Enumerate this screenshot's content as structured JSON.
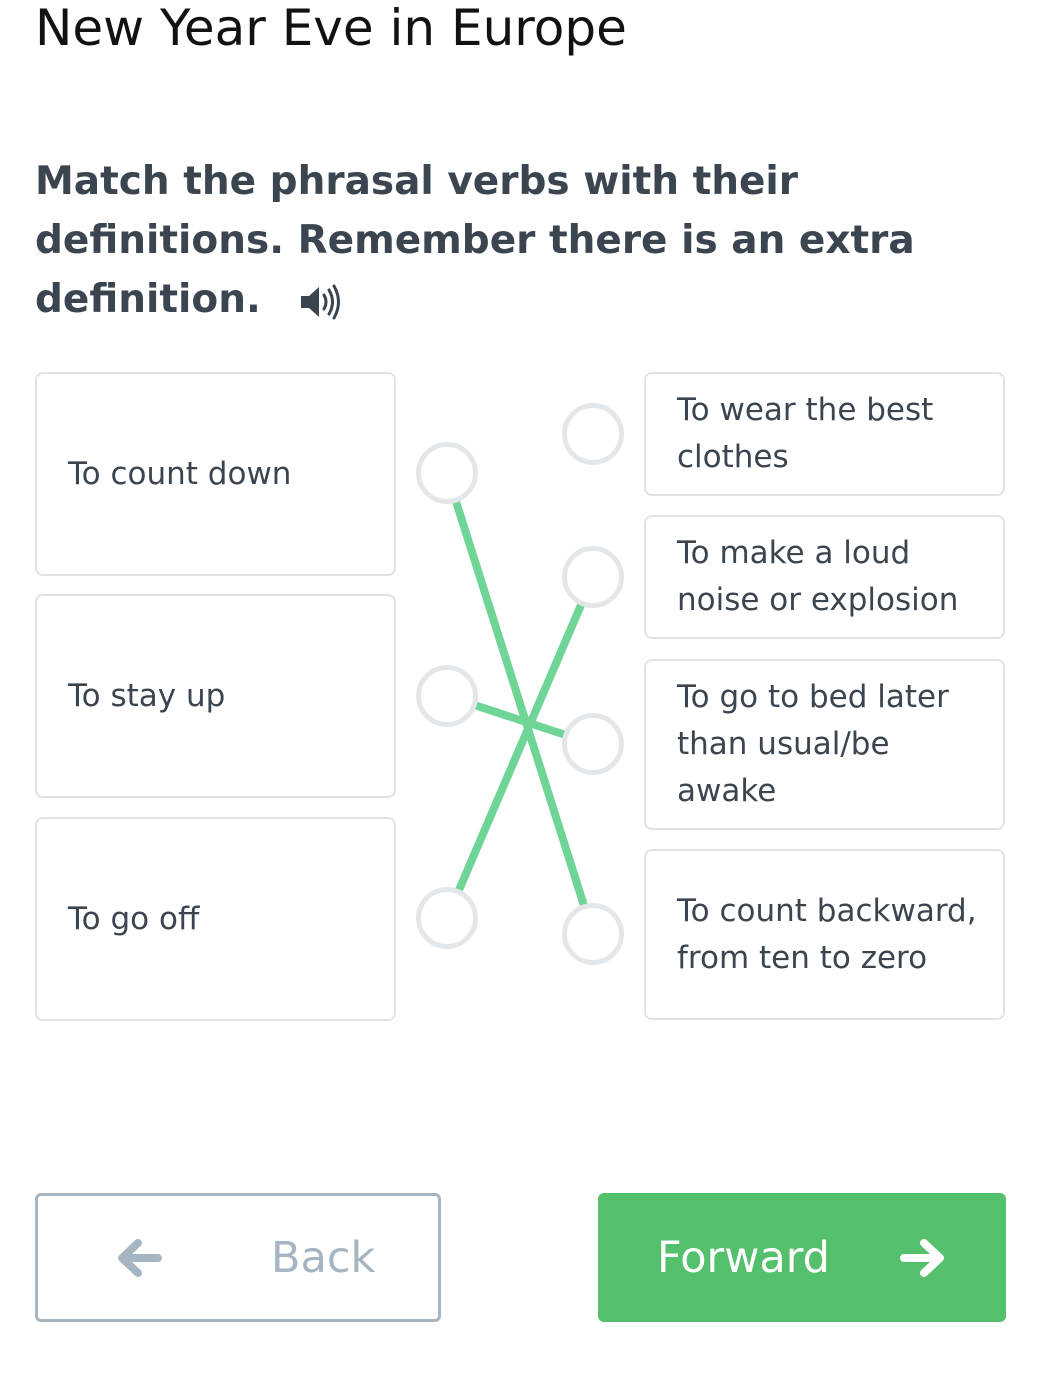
{
  "page": {
    "title": "New Year Eve in Europe"
  },
  "exercise": {
    "instructions": "Match the phrasal verbs with their definitions. Remember there is an extra definition.",
    "audio_icon": "speaker-icon",
    "phrasal_verbs": [
      {
        "text": "To count down"
      },
      {
        "text": "To stay up"
      },
      {
        "text": "To go off"
      }
    ],
    "definitions": [
      {
        "text": "To wear the best clothes"
      },
      {
        "text": "To make a loud noise or explosion"
      },
      {
        "text": "To go to bed later than usual/be awake"
      },
      {
        "text": "To count backward, from ten to zero"
      }
    ],
    "matches": [
      {
        "verb": 0,
        "definition": 3
      },
      {
        "verb": 1,
        "definition": 2
      },
      {
        "verb": 2,
        "definition": 1
      }
    ],
    "line_color": "#6ed597"
  },
  "navigation": {
    "back_label": "Back",
    "forward_label": "Forward",
    "back_icon": "arrow-left-icon",
    "forward_icon": "arrow-right-icon",
    "back_border_color": "#a5b5c1",
    "forward_color": "#54c06b"
  }
}
